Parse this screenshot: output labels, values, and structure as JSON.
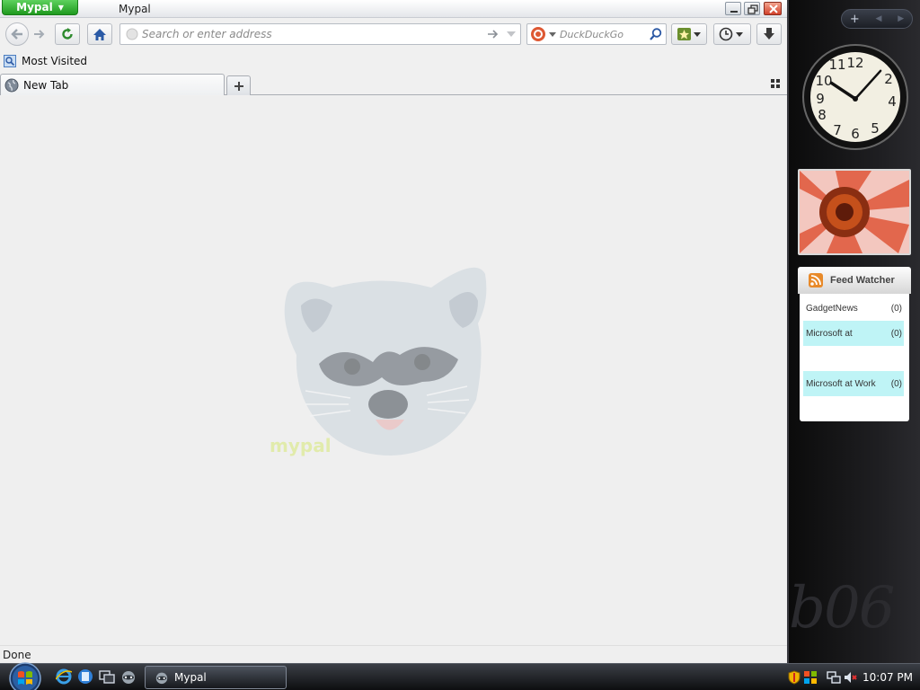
{
  "window": {
    "app_menu_label": "Mypal",
    "title": "Mypal"
  },
  "navbar": {
    "url_placeholder": "Search or enter address",
    "search_placeholder": "DuckDuckGo"
  },
  "bookmarks": {
    "most_visited_label": "Most Visited"
  },
  "tabs": [
    {
      "label": "New Tab",
      "icon": "globe-icon",
      "selected": true
    }
  ],
  "content": {
    "logo_text": "mypal"
  },
  "status": {
    "text": "Done"
  },
  "sidebar": {
    "clock": {
      "hour": 10,
      "minute": 7
    },
    "feed_watcher": {
      "title": "Feed Watcher",
      "feeds": [
        {
          "name": "GadgetNews",
          "count": "(0)",
          "highlighted": false
        },
        {
          "name": "Microsoft at",
          "count": "(0)",
          "highlighted": true
        },
        {
          "name": "",
          "count": "",
          "highlighted": false
        },
        {
          "name": "Microsoft at Work",
          "count": "(0)",
          "highlighted": true
        },
        {
          "name": "",
          "count": "",
          "highlighted": false
        }
      ]
    },
    "watermark": "b06"
  },
  "taskbar": {
    "task_label": "Mypal",
    "clock": "10:07 PM"
  },
  "colors": {
    "menu_green": "#2fb12f",
    "feed_highlight": "#bff4f6",
    "content_bg": "#efefef"
  }
}
